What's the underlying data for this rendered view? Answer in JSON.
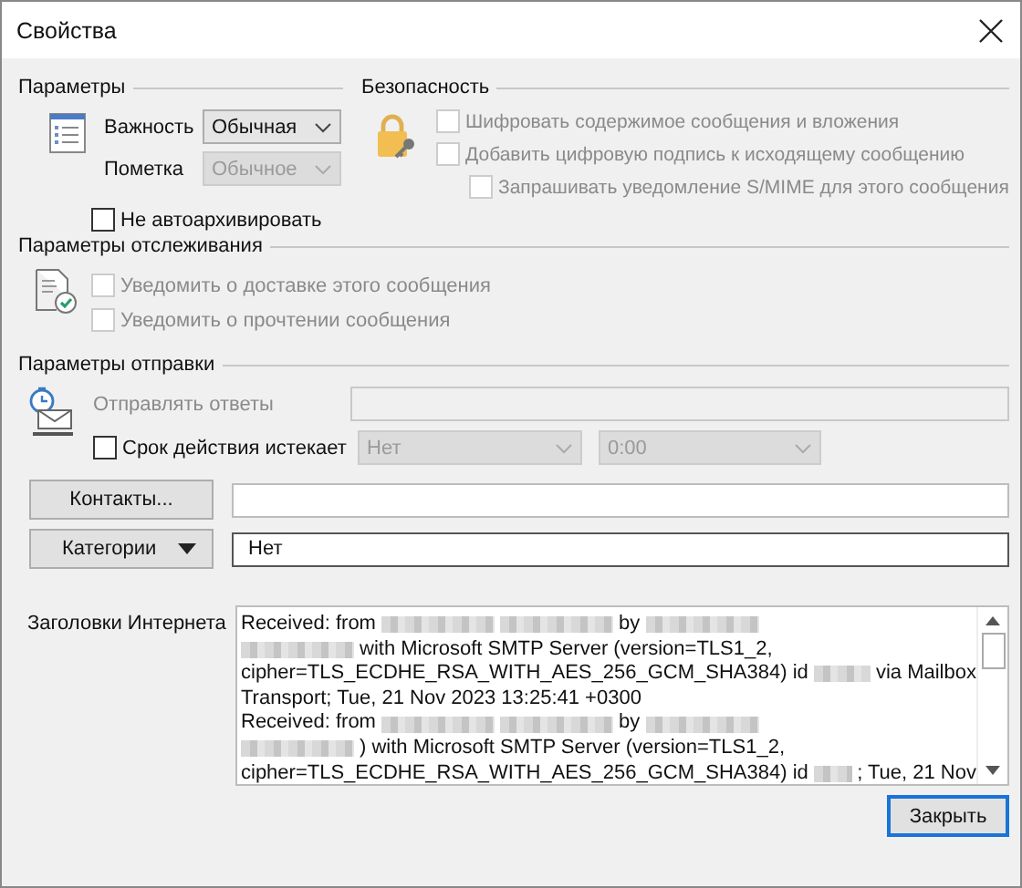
{
  "window": {
    "title": "Свойства"
  },
  "parameters": {
    "title": "Параметры",
    "importance": {
      "label": "Важность",
      "value": "Обычная",
      "disabled": false
    },
    "sensitivity": {
      "label": "Пометка",
      "value": "Обычное",
      "disabled": true
    },
    "no_autoarchive": {
      "label": "Не автоархивировать",
      "checked": false,
      "disabled": false
    }
  },
  "security": {
    "title": "Безопасность",
    "options": [
      {
        "label": "Шифровать содержимое сообщения и вложения",
        "checked": false,
        "disabled": true
      },
      {
        "label": "Добавить цифровую подпись к исходящему сообщению",
        "checked": false,
        "disabled": true,
        "children": [
          {
            "label": "Запрашивать уведомление S/MIME для этого сообщения",
            "checked": false,
            "disabled": true
          }
        ]
      }
    ]
  },
  "tracking": {
    "title": "Параметры отслеживания",
    "options": [
      {
        "label": "Уведомить о доставке этого сообщения",
        "checked": false,
        "disabled": true
      },
      {
        "label": "Уведомить о прочтении сообщения",
        "checked": false,
        "disabled": true
      }
    ]
  },
  "delivery": {
    "title": "Параметры отправки",
    "reply_to": {
      "label": "Отправлять ответы",
      "disabled": true
    },
    "expires": {
      "label": "Срок действия истекает",
      "checked": false,
      "disabled": false,
      "date": {
        "value": "Нет",
        "disabled": true
      },
      "time": {
        "value": "0:00",
        "disabled": true
      }
    }
  },
  "contacts": {
    "button": "Контакты..."
  },
  "categories": {
    "button": "Категории",
    "value": "Нет"
  },
  "internet_headers": {
    "label": "Заголовки Интернета",
    "lines": [
      [
        {
          "kind": "text",
          "text": "Received: from"
        },
        {
          "kind": "redacted"
        },
        {
          "kind": "redacted"
        },
        {
          "kind": "text",
          "text": "by"
        },
        {
          "kind": "redacted"
        }
      ],
      [
        {
          "kind": "redacted"
        },
        {
          "kind": "text",
          "text": "with Microsoft SMTP Server (version=TLS1_2,"
        }
      ],
      [
        {
          "kind": "text",
          "text": "cipher=TLS_ECDHE_RSA_WITH_AES_256_GCM_SHA384) id"
        },
        {
          "kind": "redacted"
        },
        {
          "kind": "text",
          "text": "via Mailbox"
        }
      ],
      [
        {
          "kind": "text",
          "text": "Transport; Tue, 21 Nov 2023 13:25:41 +0300"
        }
      ],
      [
        {
          "kind": "text",
          "text": "Received: from"
        },
        {
          "kind": "redacted"
        },
        {
          "kind": "redacted"
        },
        {
          "kind": "text",
          "text": "by"
        },
        {
          "kind": "redacted"
        }
      ],
      [
        {
          "kind": "redacted"
        },
        {
          "kind": "text",
          "text": ") with Microsoft SMTP Server (version=TLS1_2,"
        }
      ],
      [
        {
          "kind": "text",
          "text": "cipher=TLS_ECDHE_RSA_WITH_AES_256_GCM_SHA384) id"
        },
        {
          "kind": "redacted"
        },
        {
          "kind": "text",
          "text": "; Tue, 21 Nov"
        }
      ]
    ]
  },
  "buttons": [
    "Закрыть"
  ]
}
